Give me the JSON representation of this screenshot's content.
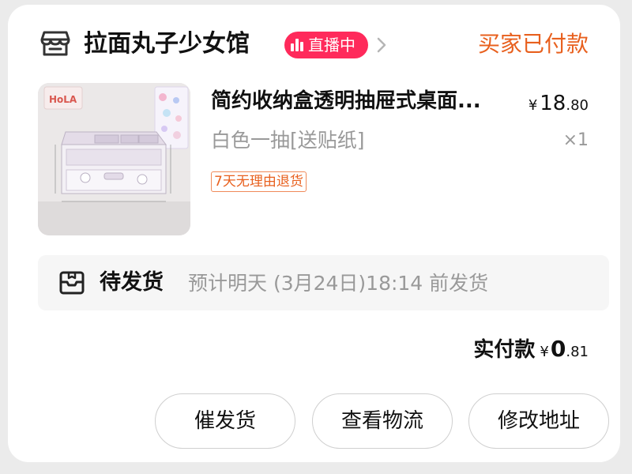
{
  "store": {
    "name": "拉面丸子少女馆",
    "icon": "store-icon",
    "live_badge": "直播中",
    "live_badge_color": "#ff2a5b"
  },
  "order": {
    "status": "买家已付款",
    "status_color": "#e8601e"
  },
  "product": {
    "title": "简约收纳盒透明抽屉式桌面...",
    "price_currency": "¥",
    "price_integer": "18",
    "price_decimal": ".80",
    "sku": "白色一抽[送贴纸]",
    "quantity": "×1",
    "return_policy": "7天无理由退货"
  },
  "shipping": {
    "icon": "package-icon",
    "status": "待发货",
    "eta": "预计明天 (3月24日)18:14 前发货"
  },
  "payment": {
    "label": "实付款",
    "currency": "¥",
    "amount_integer": "0",
    "amount_decimal": ".81"
  },
  "actions": {
    "urge_shipping": "催发货",
    "view_logistics": "查看物流",
    "modify_address": "修改地址"
  }
}
